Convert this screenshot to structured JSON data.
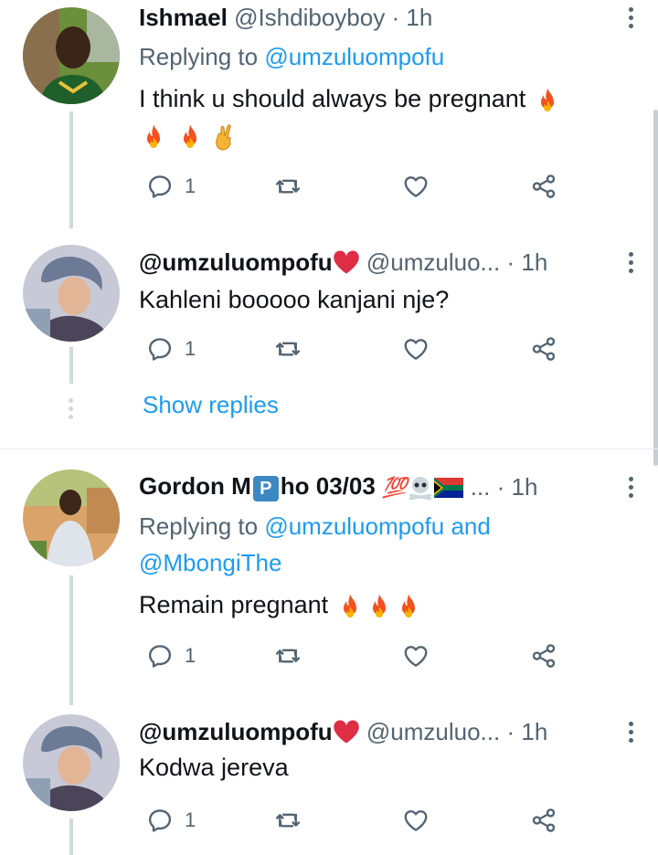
{
  "tweets": [
    {
      "name": "Ishmael",
      "handle": "@Ishdiboyboy",
      "dot": "·",
      "time": "1h",
      "replying_prefix": "Replying to ",
      "replying_to": "@umzuluompofu",
      "text": "I think u should always be pregnant",
      "reply_count": "1"
    },
    {
      "name": "@umzuluompofu",
      "handle": "@umzuluo...",
      "dot": "·",
      "time": "1h",
      "text": "Kahleni booooo kanjani nje?",
      "reply_count": "1",
      "show_replies": "Show replies"
    },
    {
      "name_part1": "Gordon M",
      "name_badge": "P",
      "name_part2": "ho 03/03",
      "name_emoji": "💯",
      "handle": "...",
      "dot": "·",
      "time": "1h",
      "replying_prefix": "Replying to ",
      "replying_to": "@umzuluompofu",
      "replying_and": " and",
      "replying_to2": "@MbongiThe",
      "text": "Remain pregnant",
      "reply_count": "1"
    },
    {
      "name": "@umzuluompofu",
      "handle": "@umzuluo...",
      "dot": "·",
      "time": "1h",
      "text": "Kodwa jereva",
      "reply_count": "1"
    }
  ],
  "icons": {
    "reply": "reply-icon",
    "retweet": "retweet-icon",
    "like": "heart-icon",
    "share": "share-icon"
  },
  "colors": {
    "link": "#1d9bf0",
    "secondary_text": "#536471",
    "thread_line": "#cfd9de"
  }
}
